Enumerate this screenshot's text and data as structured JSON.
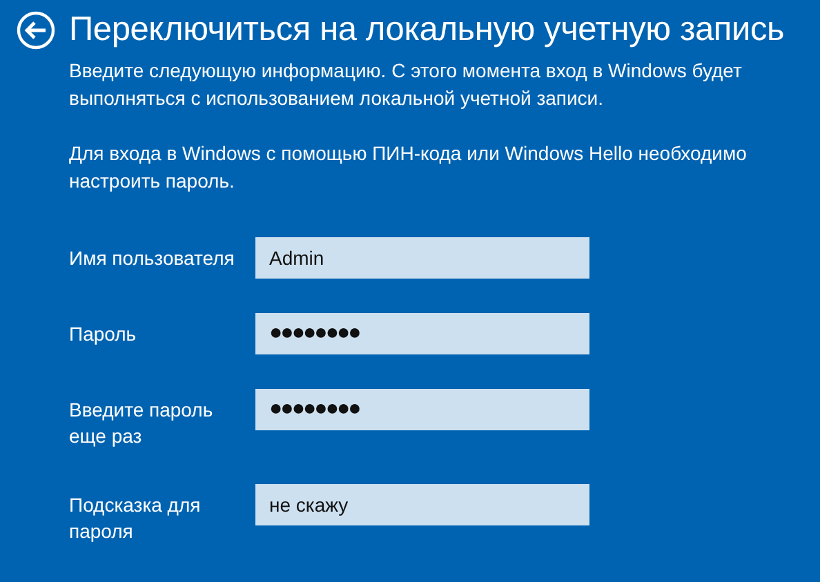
{
  "title": "Переключиться на локальную учетную запись",
  "paragraphs": [
    "Введите следующую информацию. С этого момента вход в Windows будет выполняться с использованием локальной учетной записи.",
    "Для входа в Windows с помощью ПИН-кода или Windows Hello необходимо настроить пароль."
  ],
  "fields": [
    {
      "label": "Имя пользователя",
      "kind": "text",
      "value": "Admin"
    },
    {
      "label": "Пароль",
      "kind": "password",
      "value": "●●●●●●●●"
    },
    {
      "label": "Введите пароль еще раз",
      "kind": "password",
      "value": "●●●●●●●●"
    },
    {
      "label": "Подсказка для пароля",
      "kind": "text",
      "value": "не скажу"
    }
  ]
}
